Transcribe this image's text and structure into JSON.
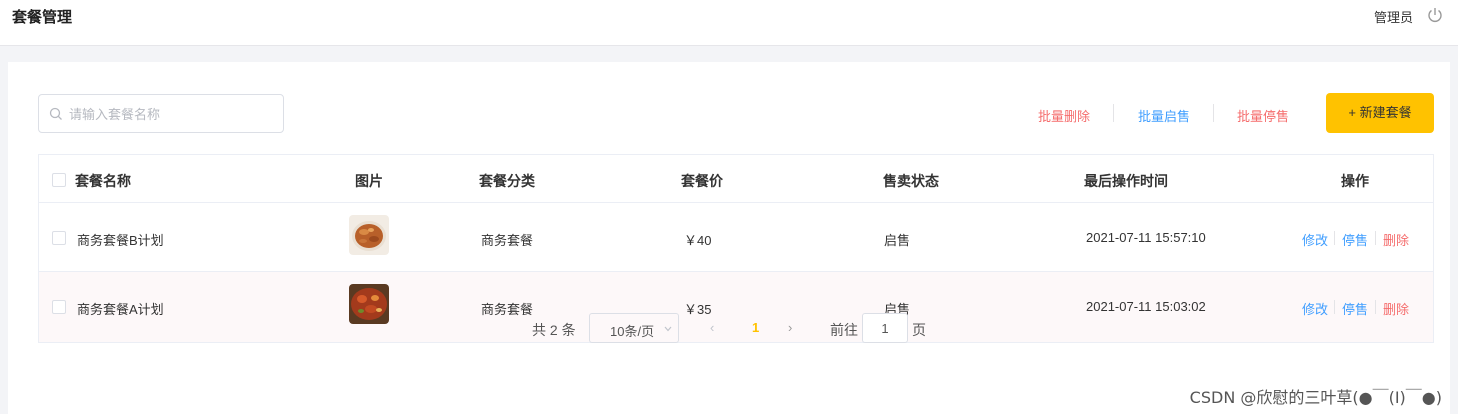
{
  "header": {
    "title": "套餐管理",
    "user": "管理员"
  },
  "toolbar": {
    "search_placeholder": "请输入套餐名称",
    "batch_delete": "批量删除",
    "batch_on_sale": "批量启售",
    "batch_off_sale": "批量停售",
    "new_button": "+ 新建套餐"
  },
  "table": {
    "columns": [
      "套餐名称",
      "图片",
      "套餐分类",
      "套餐价",
      "售卖状态",
      "最后操作时间",
      "操作"
    ],
    "rows": [
      {
        "name": "商务套餐B计划",
        "category": "商务套餐",
        "price": "￥40",
        "status": "启售",
        "updated": "2021-07-11 15:57:10",
        "image": "food-photo"
      },
      {
        "name": "商务套餐A计划",
        "category": "商务套餐",
        "price": "￥35",
        "status": "启售",
        "updated": "2021-07-11 15:03:02",
        "image": "food-photo"
      }
    ],
    "actions": {
      "edit": "修改",
      "stop": "停售",
      "delete": "删除"
    }
  },
  "pagination": {
    "total": "共 2 条",
    "page_size": "10条/页",
    "current_page": "1",
    "goto_label": "前往",
    "goto_value": "1",
    "goto_unit": "页"
  },
  "watermark": "CSDN @欣慰的三叶草(●￣(I)￣●)",
  "colors": {
    "accent": "#ffc200",
    "link_blue": "#409eff",
    "danger_red": "#f56c6c"
  }
}
